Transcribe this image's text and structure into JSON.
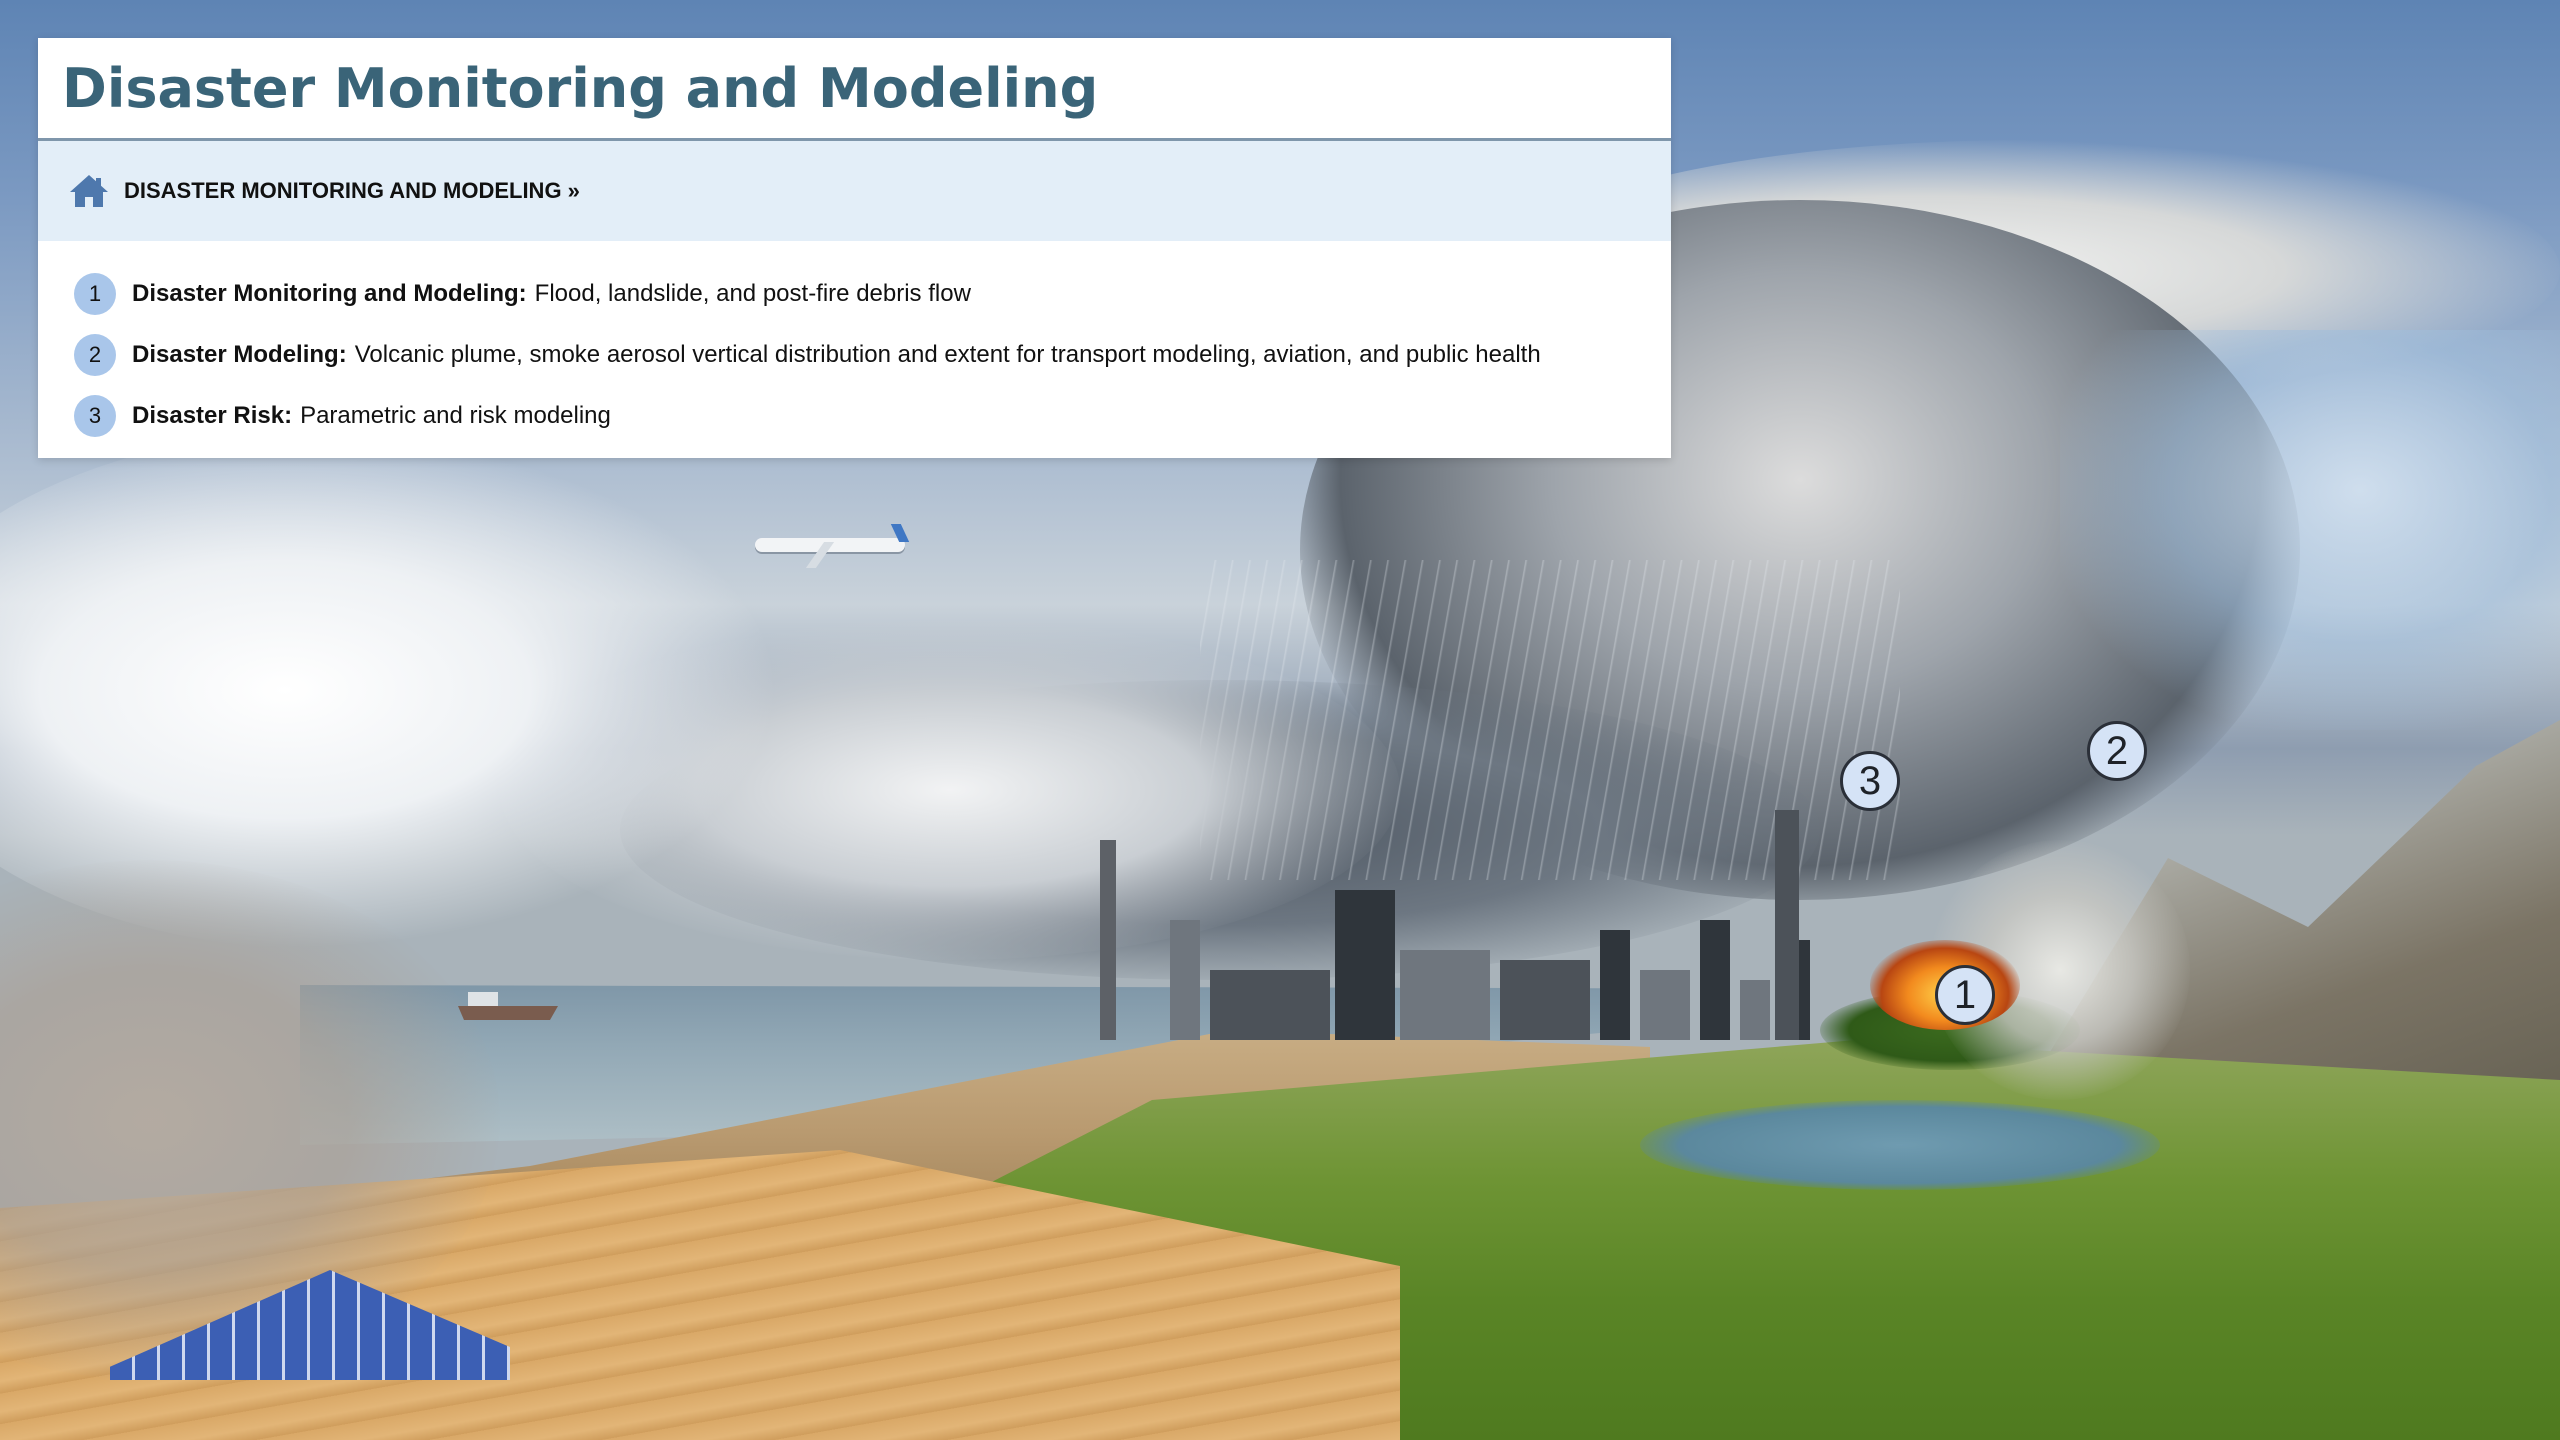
{
  "panel": {
    "title": "Disaster Monitoring and Modeling",
    "breadcrumb": "DISASTER MONITORING AND MODELING »",
    "items": [
      {
        "number": "1",
        "label": "Disaster Monitoring and Modeling:",
        "text": "Flood, landslide, and post-fire debris flow"
      },
      {
        "number": "2",
        "label": "Disaster Modeling:",
        "text": "Volcanic plume, smoke aerosol vertical distribution and extent for transport modeling, aviation, and public health"
      },
      {
        "number": "3",
        "label": "Disaster Risk:",
        "text": "Parametric and risk modeling"
      }
    ]
  },
  "markers": [
    {
      "number": "1"
    },
    {
      "number": "2"
    },
    {
      "number": "3"
    }
  ],
  "icons": {
    "breadcrumb_home": "home-icon"
  },
  "colors": {
    "title": "#3a6478",
    "crumb_bg": "#e3eef8",
    "badge": "#a9c6ea",
    "marker": "#d5e3f6"
  }
}
